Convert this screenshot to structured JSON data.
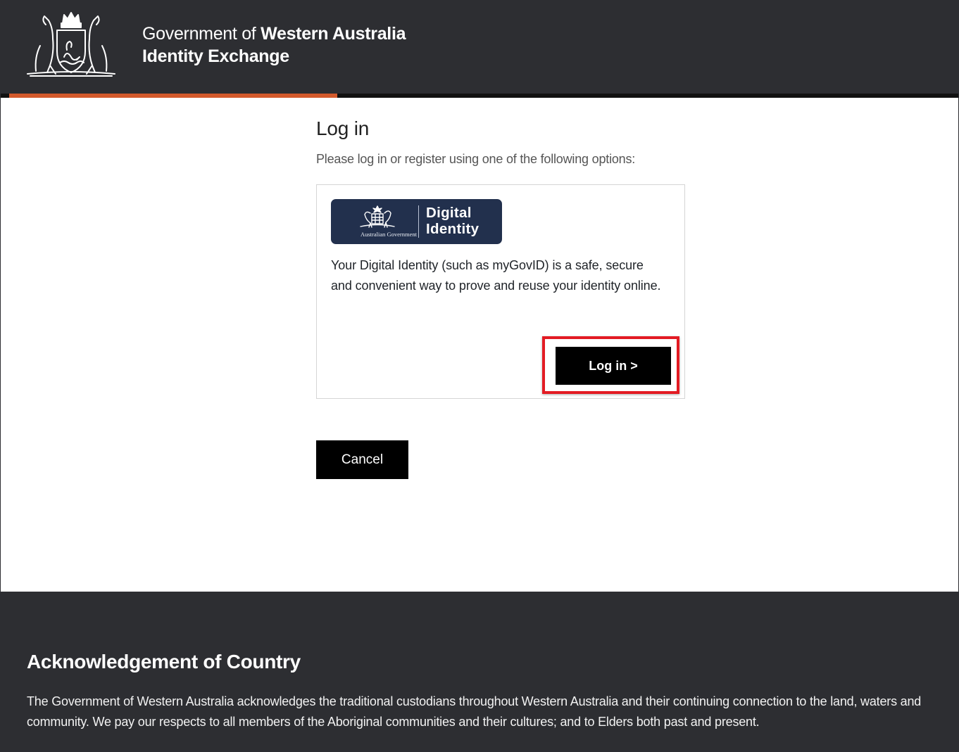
{
  "header": {
    "brand_prefix": "Government of",
    "brand_name": "Western Australia",
    "product_name": "Identity Exchange",
    "crest_icon": "wa-coat-of-arms-icon",
    "accent_color": "#d35a2c",
    "background_color": "#2d2e32"
  },
  "main": {
    "title": "Log in",
    "intro": "Please log in or register using one of the following options:",
    "option": {
      "logo_org": "Australian Government",
      "logo_title_line1": "Digital",
      "logo_title_line2": "Identity",
      "logo_color": "#22304d",
      "description": "Your Digital Identity (such as myGovID) is a safe, secure and convenient way to prove and reuse your identity online.",
      "login_label": "Log in >",
      "highlight_color": "#e31b23"
    },
    "cancel_label": "Cancel"
  },
  "footer": {
    "heading": "Acknowledgement of Country",
    "text": "The Government of Western Australia acknowledges the traditional custodians throughout Western Australia and their continuing connection to the land, waters and community. We pay our respects to all members of the Aboriginal communities and their cultures; and to Elders both past and present."
  }
}
